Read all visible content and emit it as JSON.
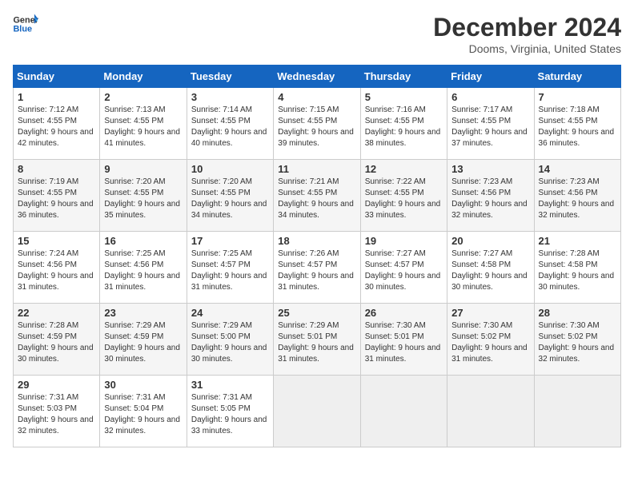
{
  "logo": {
    "general": "General",
    "blue": "Blue"
  },
  "title": "December 2024",
  "subtitle": "Dooms, Virginia, United States",
  "days_header": [
    "Sunday",
    "Monday",
    "Tuesday",
    "Wednesday",
    "Thursday",
    "Friday",
    "Saturday"
  ],
  "weeks": [
    [
      {
        "num": "1",
        "sunrise": "7:12 AM",
        "sunset": "4:55 PM",
        "daylight": "9 hours and 42 minutes."
      },
      {
        "num": "2",
        "sunrise": "7:13 AM",
        "sunset": "4:55 PM",
        "daylight": "9 hours and 41 minutes."
      },
      {
        "num": "3",
        "sunrise": "7:14 AM",
        "sunset": "4:55 PM",
        "daylight": "9 hours and 40 minutes."
      },
      {
        "num": "4",
        "sunrise": "7:15 AM",
        "sunset": "4:55 PM",
        "daylight": "9 hours and 39 minutes."
      },
      {
        "num": "5",
        "sunrise": "7:16 AM",
        "sunset": "4:55 PM",
        "daylight": "9 hours and 38 minutes."
      },
      {
        "num": "6",
        "sunrise": "7:17 AM",
        "sunset": "4:55 PM",
        "daylight": "9 hours and 37 minutes."
      },
      {
        "num": "7",
        "sunrise": "7:18 AM",
        "sunset": "4:55 PM",
        "daylight": "9 hours and 36 minutes."
      }
    ],
    [
      {
        "num": "8",
        "sunrise": "7:19 AM",
        "sunset": "4:55 PM",
        "daylight": "9 hours and 36 minutes."
      },
      {
        "num": "9",
        "sunrise": "7:20 AM",
        "sunset": "4:55 PM",
        "daylight": "9 hours and 35 minutes."
      },
      {
        "num": "10",
        "sunrise": "7:20 AM",
        "sunset": "4:55 PM",
        "daylight": "9 hours and 34 minutes."
      },
      {
        "num": "11",
        "sunrise": "7:21 AM",
        "sunset": "4:55 PM",
        "daylight": "9 hours and 34 minutes."
      },
      {
        "num": "12",
        "sunrise": "7:22 AM",
        "sunset": "4:55 PM",
        "daylight": "9 hours and 33 minutes."
      },
      {
        "num": "13",
        "sunrise": "7:23 AM",
        "sunset": "4:56 PM",
        "daylight": "9 hours and 32 minutes."
      },
      {
        "num": "14",
        "sunrise": "7:23 AM",
        "sunset": "4:56 PM",
        "daylight": "9 hours and 32 minutes."
      }
    ],
    [
      {
        "num": "15",
        "sunrise": "7:24 AM",
        "sunset": "4:56 PM",
        "daylight": "9 hours and 31 minutes."
      },
      {
        "num": "16",
        "sunrise": "7:25 AM",
        "sunset": "4:56 PM",
        "daylight": "9 hours and 31 minutes."
      },
      {
        "num": "17",
        "sunrise": "7:25 AM",
        "sunset": "4:57 PM",
        "daylight": "9 hours and 31 minutes."
      },
      {
        "num": "18",
        "sunrise": "7:26 AM",
        "sunset": "4:57 PM",
        "daylight": "9 hours and 31 minutes."
      },
      {
        "num": "19",
        "sunrise": "7:27 AM",
        "sunset": "4:57 PM",
        "daylight": "9 hours and 30 minutes."
      },
      {
        "num": "20",
        "sunrise": "7:27 AM",
        "sunset": "4:58 PM",
        "daylight": "9 hours and 30 minutes."
      },
      {
        "num": "21",
        "sunrise": "7:28 AM",
        "sunset": "4:58 PM",
        "daylight": "9 hours and 30 minutes."
      }
    ],
    [
      {
        "num": "22",
        "sunrise": "7:28 AM",
        "sunset": "4:59 PM",
        "daylight": "9 hours and 30 minutes."
      },
      {
        "num": "23",
        "sunrise": "7:29 AM",
        "sunset": "4:59 PM",
        "daylight": "9 hours and 30 minutes."
      },
      {
        "num": "24",
        "sunrise": "7:29 AM",
        "sunset": "5:00 PM",
        "daylight": "9 hours and 30 minutes."
      },
      {
        "num": "25",
        "sunrise": "7:29 AM",
        "sunset": "5:01 PM",
        "daylight": "9 hours and 31 minutes."
      },
      {
        "num": "26",
        "sunrise": "7:30 AM",
        "sunset": "5:01 PM",
        "daylight": "9 hours and 31 minutes."
      },
      {
        "num": "27",
        "sunrise": "7:30 AM",
        "sunset": "5:02 PM",
        "daylight": "9 hours and 31 minutes."
      },
      {
        "num": "28",
        "sunrise": "7:30 AM",
        "sunset": "5:02 PM",
        "daylight": "9 hours and 32 minutes."
      }
    ],
    [
      {
        "num": "29",
        "sunrise": "7:31 AM",
        "sunset": "5:03 PM",
        "daylight": "9 hours and 32 minutes."
      },
      {
        "num": "30",
        "sunrise": "7:31 AM",
        "sunset": "5:04 PM",
        "daylight": "9 hours and 32 minutes."
      },
      {
        "num": "31",
        "sunrise": "7:31 AM",
        "sunset": "5:05 PM",
        "daylight": "9 hours and 33 minutes."
      },
      null,
      null,
      null,
      null
    ]
  ],
  "labels": {
    "sunrise": "Sunrise:",
    "sunset": "Sunset:",
    "daylight": "Daylight:"
  }
}
